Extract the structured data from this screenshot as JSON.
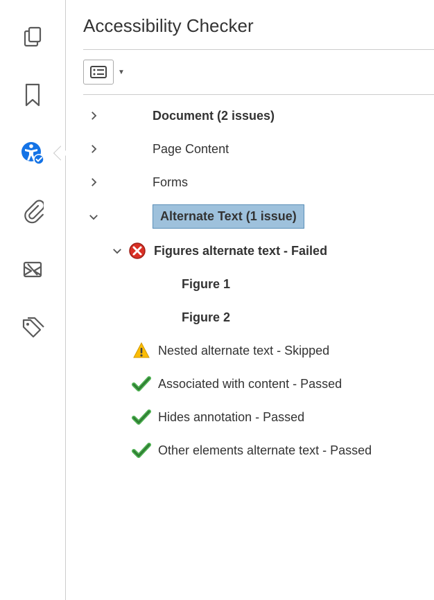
{
  "panel": {
    "title": "Accessibility Checker"
  },
  "sidebar": {
    "items": [
      {
        "name": "pages-icon"
      },
      {
        "name": "bookmark-icon"
      },
      {
        "name": "accessibility-icon"
      },
      {
        "name": "attachment-icon"
      },
      {
        "name": "signature-icon"
      },
      {
        "name": "tags-icon"
      }
    ]
  },
  "toolbar": {
    "options_button": "Options"
  },
  "tree": {
    "rows": [
      {
        "id": "document",
        "label": "Document (2 issues)",
        "bold": true,
        "expanded": false,
        "indent": 1
      },
      {
        "id": "pagecontent",
        "label": "Page Content",
        "bold": false,
        "expanded": false,
        "indent": 1
      },
      {
        "id": "forms",
        "label": "Forms",
        "bold": false,
        "expanded": false,
        "indent": 1
      },
      {
        "id": "alttext",
        "label": "Alternate Text (1 issue)",
        "bold": true,
        "selected": true,
        "expanded": true,
        "indent": 1
      },
      {
        "id": "figures",
        "label": "Figures alternate text - Failed",
        "bold": true,
        "status": "failed",
        "expanded": true,
        "indent": 2
      },
      {
        "id": "fig1",
        "label": "Figure 1",
        "bold": true,
        "leaf": true,
        "indent": 3
      },
      {
        "id": "fig2",
        "label": "Figure 2",
        "bold": true,
        "leaf": true,
        "indent": 3
      },
      {
        "id": "nested",
        "label": "Nested alternate text - Skipped",
        "status": "warning",
        "indent": 2,
        "nochevron": true
      },
      {
        "id": "assoc",
        "label": "Associated with content - Passed",
        "status": "passed",
        "indent": 2,
        "nochevron": true
      },
      {
        "id": "hides",
        "label": "Hides annotation - Passed",
        "status": "passed",
        "indent": 2,
        "nochevron": true
      },
      {
        "id": "other",
        "label": "Other elements alternate text - Passed",
        "status": "passed",
        "indent": 2,
        "nochevron": true
      }
    ]
  }
}
